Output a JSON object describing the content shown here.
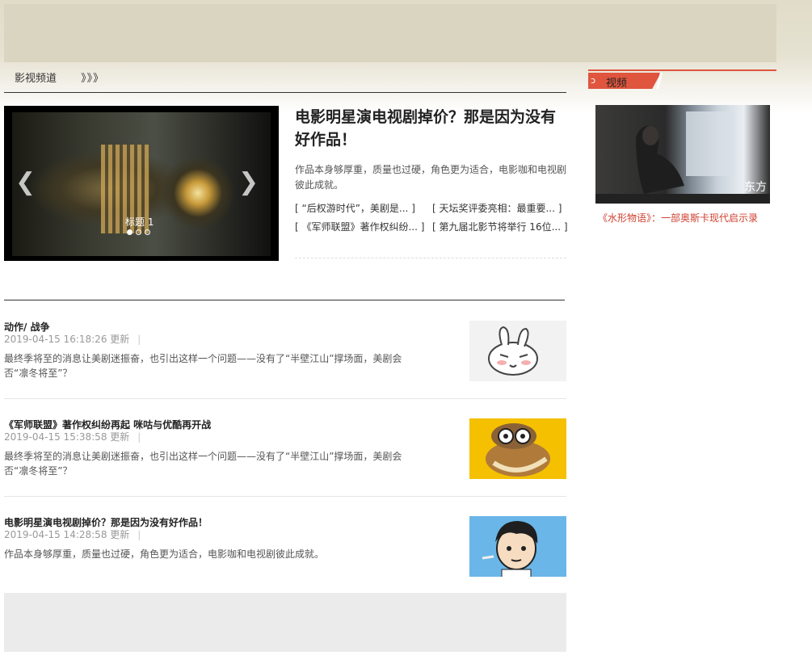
{
  "header": {
    "channel": "影视频道",
    "chevrons": "》》》"
  },
  "slider": {
    "caption": "标题 1",
    "prev_icon": "chevron-left-icon",
    "next_icon": "chevron-right-icon",
    "slide_count": 3,
    "active_slide": 1
  },
  "featured": {
    "title": "电影明星演电视剧掉价？那是因为没有好作品！",
    "summary": "作品本身够厚重，质量也过硬，角色更为适合，电影咖和电视剧彼此成就。",
    "links": [
      "[ “后权游时代”，美剧是... ]",
      "[ 天坛奖评委亮相：最重要... ]",
      "[ 《军师联盟》著作权纠纷... ]",
      "[ 第九届北影节将举行 16位... ]"
    ]
  },
  "articles": [
    {
      "title": "动作/ 战争",
      "date": "2019-04-15 16:18:26 更新",
      "desc": "最终季将至的消息让美剧迷振奋，也引出这样一个问题——没有了“半壁江山”撑场面，美剧会否“凛冬将至”？",
      "thumb": "rabbit-sticker-image"
    },
    {
      "title": "《军师联盟》著作权纠纷再起 咪咕与优酷再开战",
      "date": "2019-04-15 15:38:58 更新",
      "desc": "最终季将至的消息让美剧迷振奋，也引出这样一个问题——没有了“半壁江山”撑场面，美剧会否“凛冬将至”？",
      "thumb": "lemur-cartoon-image"
    },
    {
      "title": "电影明星演电视剧掉价？那是因为没有好作品！",
      "date": "2019-04-15 14:28:58 更新",
      "desc": "作品本身够厚重，质量也过硬，角色更为适合，电影咖和电视剧彼此成就。",
      "thumb": "boy-cartoon-image"
    }
  ],
  "sidebar": {
    "section_title": "视频",
    "video_caption": "《水形物语》：一部奥斯卡现代启示录",
    "video_watermark": "东方 你"
  },
  "colors": {
    "accent": "#e0553e",
    "caption_red": "#d04030"
  }
}
